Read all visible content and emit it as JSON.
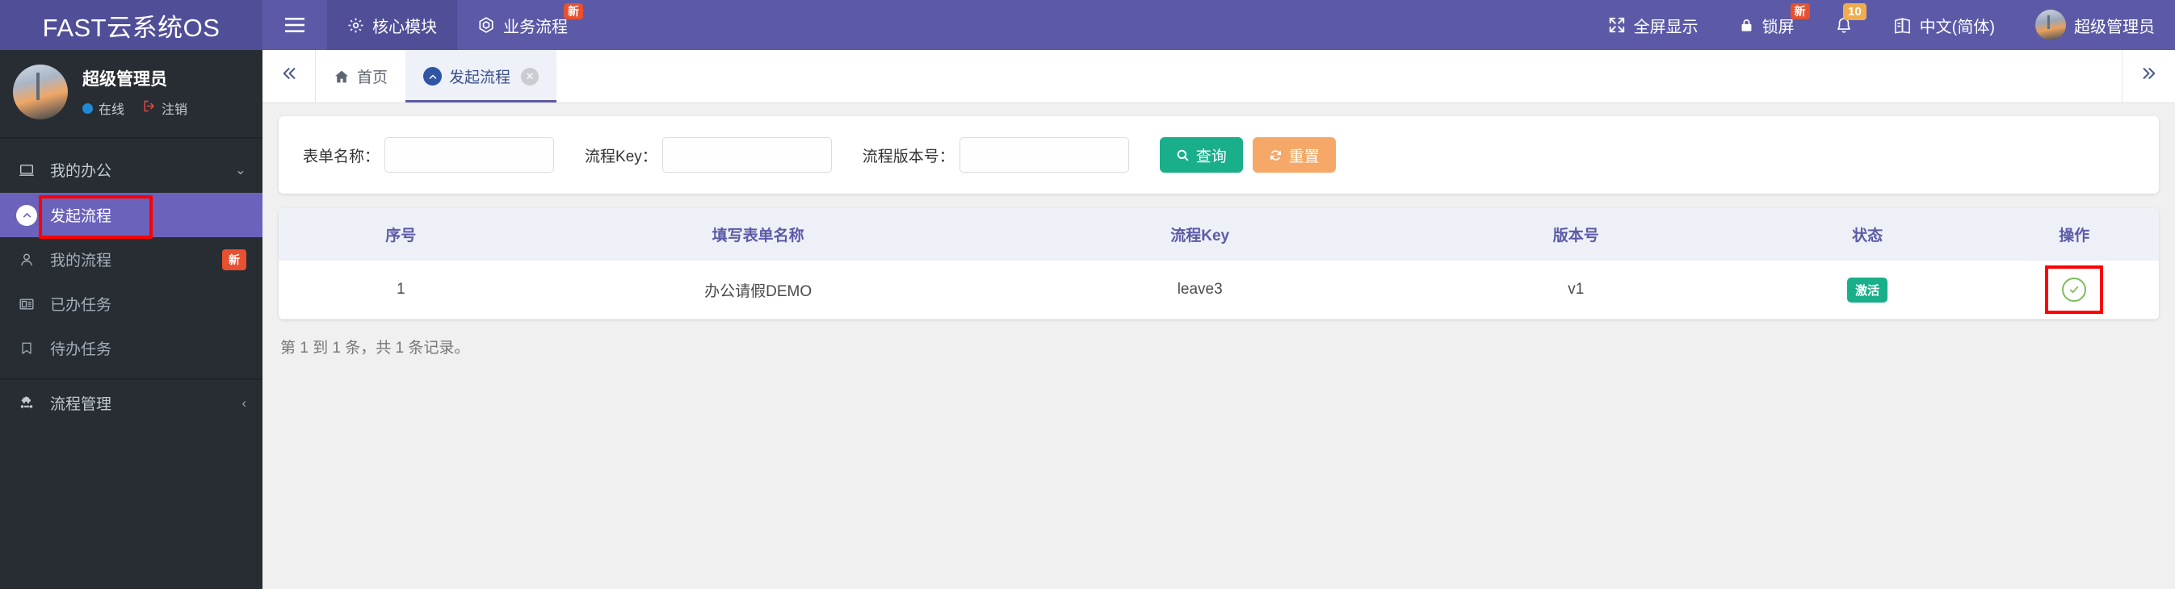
{
  "brand": {
    "title": "FAST云系统OS"
  },
  "topnav": {
    "hamburger_icon": "hamburger-icon",
    "items": [
      {
        "label": "核心模块",
        "icon": "gear-icon",
        "active": true,
        "badge": ""
      },
      {
        "label": "业务流程",
        "icon": "cube-icon",
        "active": false,
        "badge": "新"
      }
    ],
    "right": [
      {
        "label": "全屏显示",
        "icon": "fullscreen-icon",
        "badge": ""
      },
      {
        "label": "锁屏",
        "icon": "lock-icon",
        "badge": "新"
      },
      {
        "label": "",
        "icon": "bell-icon",
        "badge": "10"
      },
      {
        "label": "中文(简体)",
        "icon": "language-icon",
        "badge": ""
      },
      {
        "label": "超级管理员",
        "icon": "avatar",
        "badge": ""
      }
    ]
  },
  "sidebar": {
    "profile": {
      "name": "超级管理员",
      "status_label": "在线",
      "logout_label": "注销",
      "status_color": "#1e8ad6",
      "logout_color": "#e04a3f",
      "avatar_icon": "avatar"
    },
    "groups": [
      {
        "label": "我的办公",
        "icon": "laptop-icon",
        "chevron": "chevron-down-icon",
        "items": [
          {
            "label": "发起流程",
            "icon": "circle-up-icon",
            "selected": true,
            "badge": "",
            "highlighted": true
          },
          {
            "label": "我的流程",
            "icon": "user-icon",
            "selected": false,
            "badge": "新",
            "highlighted": false
          },
          {
            "label": "已办任务",
            "icon": "list-box-icon",
            "selected": false,
            "badge": "",
            "highlighted": false
          },
          {
            "label": "待办任务",
            "icon": "bookmark-icon",
            "selected": false,
            "badge": "",
            "highlighted": false
          }
        ]
      },
      {
        "label": "流程管理",
        "icon": "puzzle-icon",
        "chevron": "chevron-left-icon",
        "items": []
      }
    ]
  },
  "tabbar": {
    "collapse_icon": "double-chevron-left-icon",
    "expand_icon": "double-chevron-right-icon",
    "tabs": [
      {
        "label": "首页",
        "icon": "home-icon",
        "active": false,
        "closable": false
      },
      {
        "label": "发起流程",
        "icon": "circle-up-icon",
        "active": true,
        "closable": true,
        "close_icon": "close-icon"
      }
    ]
  },
  "search": {
    "fields": [
      {
        "label": "表单名称：",
        "value": "",
        "placeholder": "",
        "name": "form-name-input"
      },
      {
        "label": "流程Key：",
        "value": "",
        "placeholder": "",
        "name": "process-key-input"
      },
      {
        "label": "流程版本号：",
        "value": "",
        "placeholder": "",
        "name": "process-version-input"
      }
    ],
    "search_button": {
      "label": "查询",
      "icon": "search-icon",
      "color": "#1aaf8b"
    },
    "reset_button": {
      "label": "重置",
      "icon": "refresh-icon",
      "color": "#f5a868"
    }
  },
  "table": {
    "headers": [
      "序号",
      "填写表单名称",
      "流程Key",
      "版本号",
      "状态",
      "操作"
    ],
    "rows": [
      {
        "seq": "1",
        "form_name": "办公请假DEMO",
        "process_key": "leave3",
        "version": "v1",
        "status": "激活",
        "status_color": "#1aaf8b",
        "action_icon": "check-circle-icon"
      }
    ]
  },
  "pager": {
    "text": "第 1 到 1 条，共 1 条记录。"
  },
  "theme": {
    "header_bg": "#5c5aa7",
    "brand_bg": "#514e98",
    "sidebar_bg": "#282d33",
    "selected_bg": "#6a62bb",
    "highlight_box": "#ff0000",
    "table_header_bg": "#edf0f7",
    "table_header_fg": "#5c5aa7"
  }
}
